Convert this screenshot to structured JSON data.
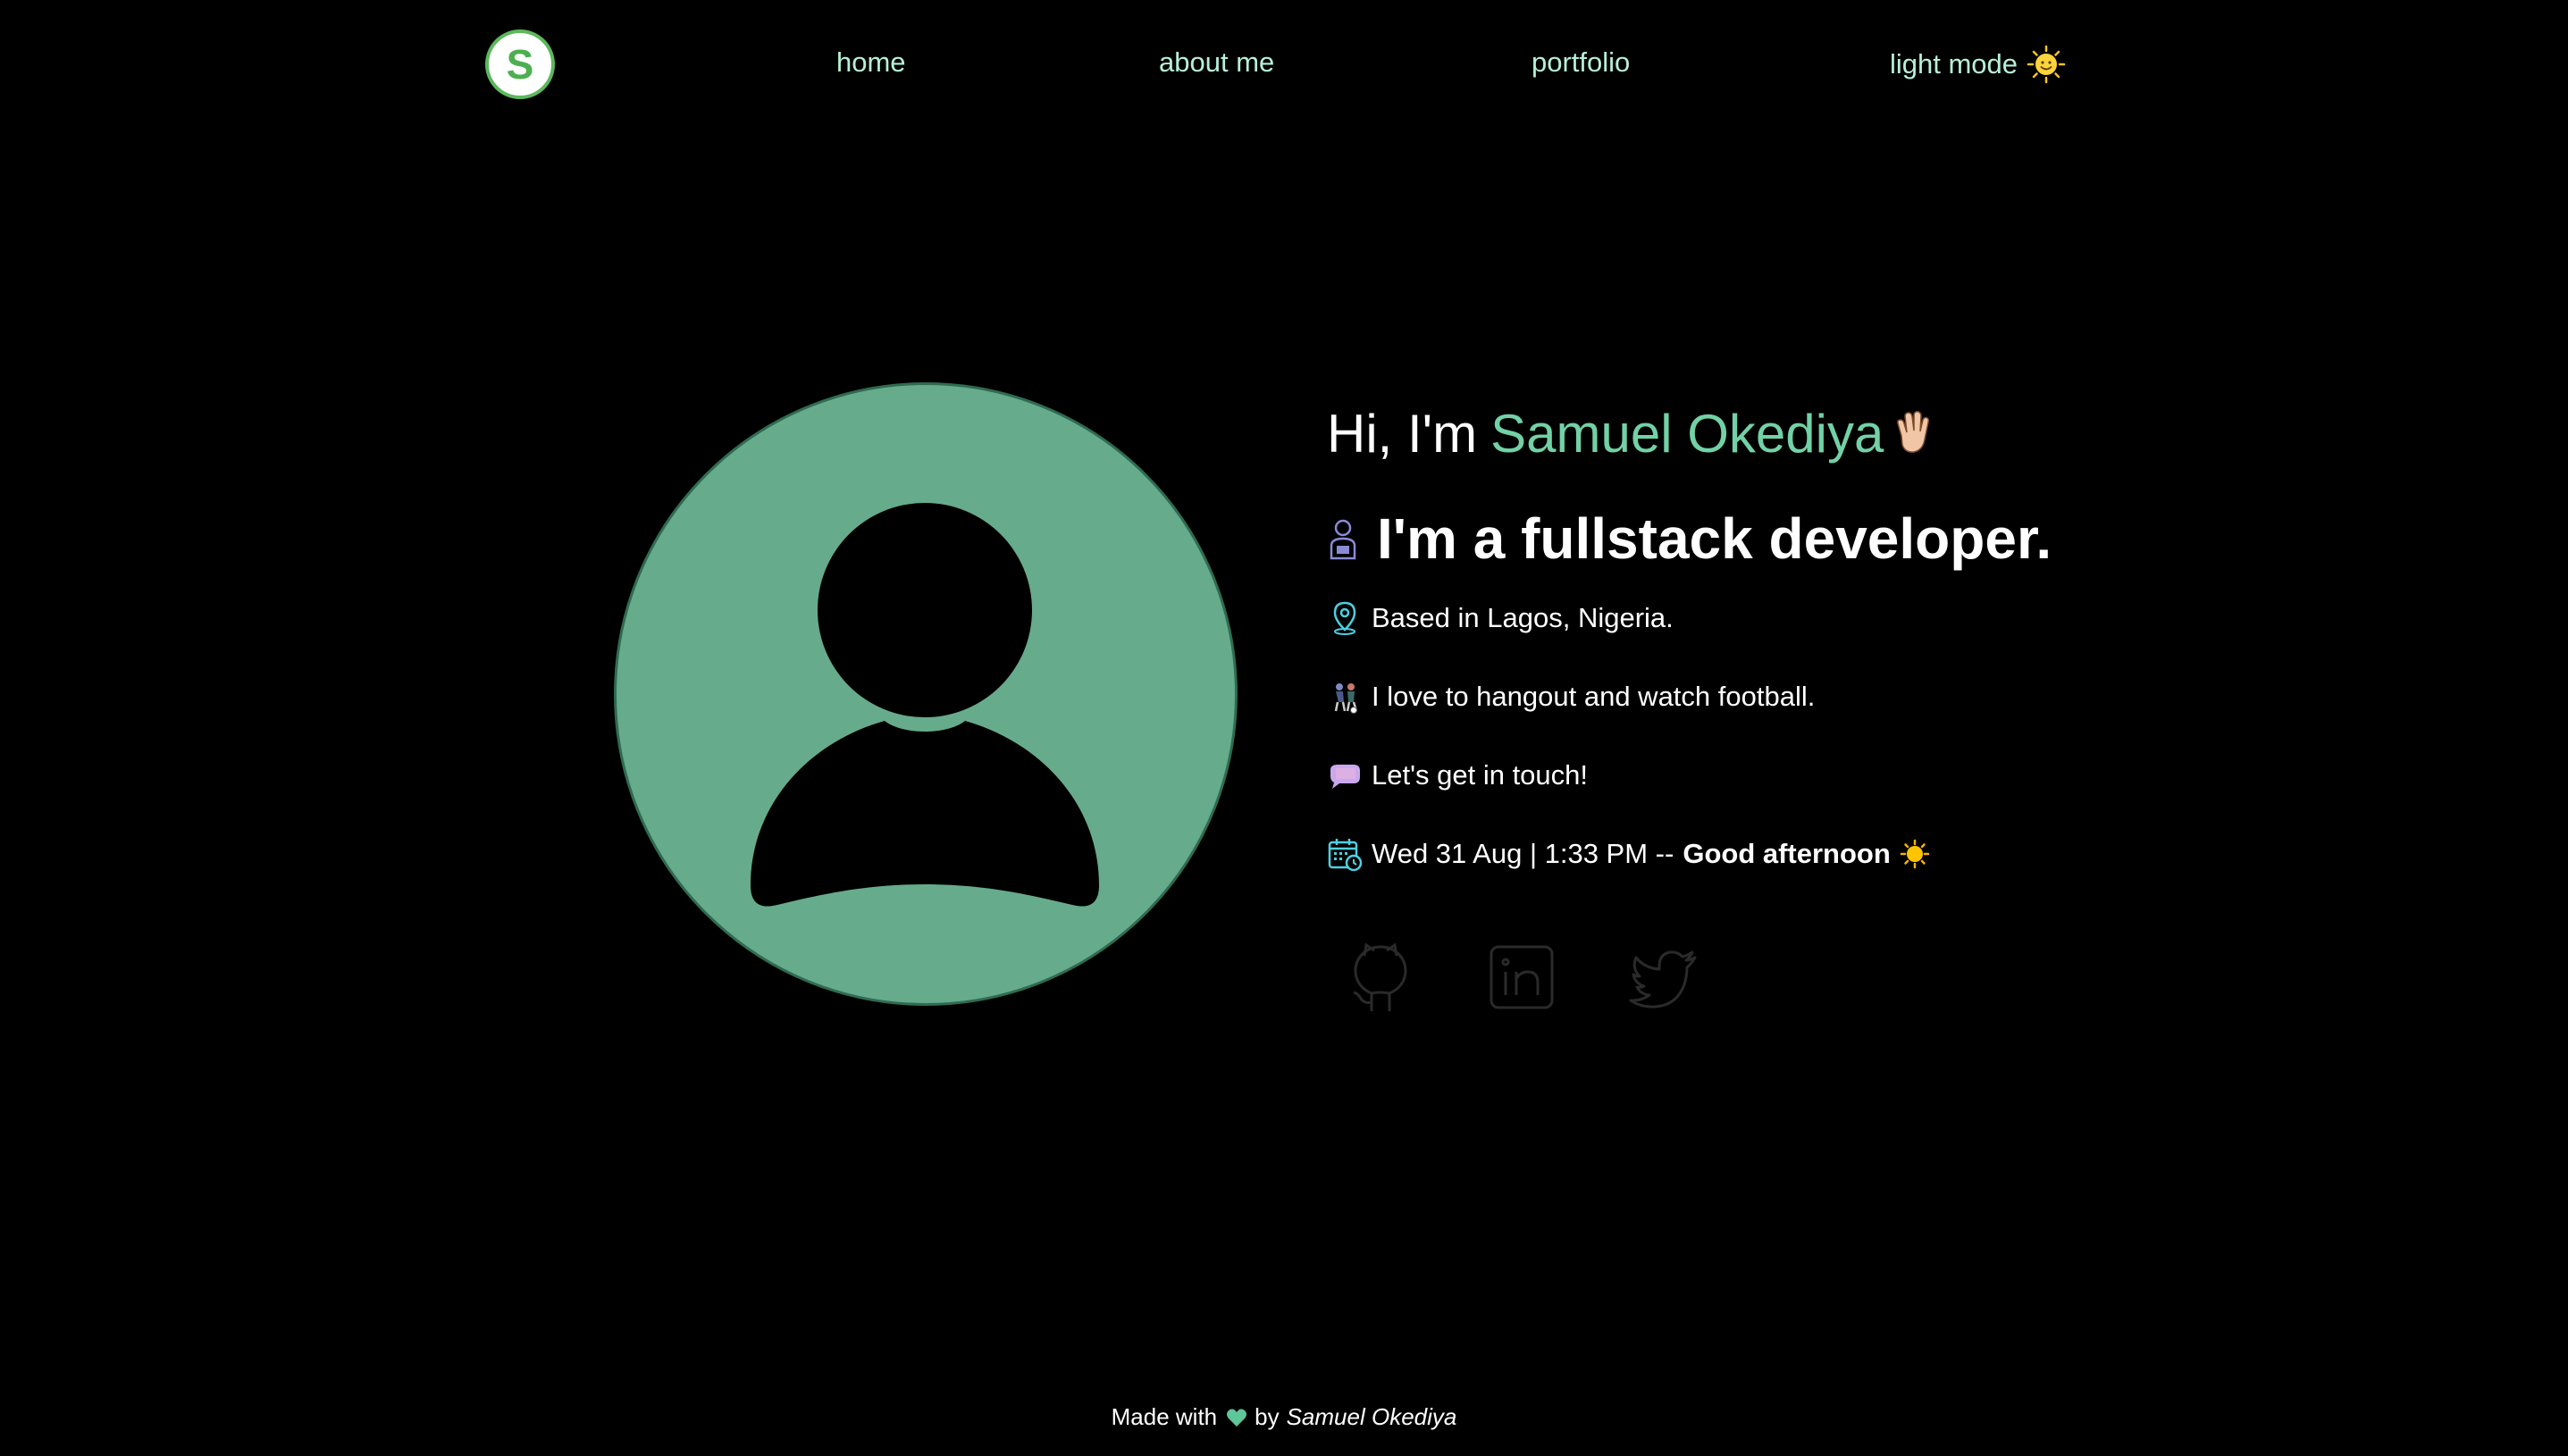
{
  "nav": {
    "logo_letter": "S",
    "links": [
      {
        "label": "home"
      },
      {
        "label": "about me"
      },
      {
        "label": "portfolio"
      }
    ],
    "theme_toggle": "light mode",
    "theme_icon": "sun-face-icon"
  },
  "intro": {
    "greeting": "Hi, I'm",
    "name": "Samuel Okediya",
    "role": "I'm a fullstack developer.",
    "location": "Based in Lagos, Nigeria.",
    "hobbies": "I love to hangout and watch football.",
    "contact": "Let's get in touch!",
    "datetime": "Wed 31 Aug | 1:33 PM --",
    "greeting_time": "Good afternoon"
  },
  "socials": [
    {
      "name": "github-icon"
    },
    {
      "name": "linkedin-icon"
    },
    {
      "name": "twitter-icon"
    }
  ],
  "footer": {
    "made_with": "Made with",
    "by": "by",
    "author": "Samuel Okediya"
  },
  "colors": {
    "background": "#000000",
    "accent": "#72d1a6",
    "nav_link": "#b7f0d6",
    "avatar_bg": "#66ab8c",
    "logo_green": "#4caf50"
  }
}
